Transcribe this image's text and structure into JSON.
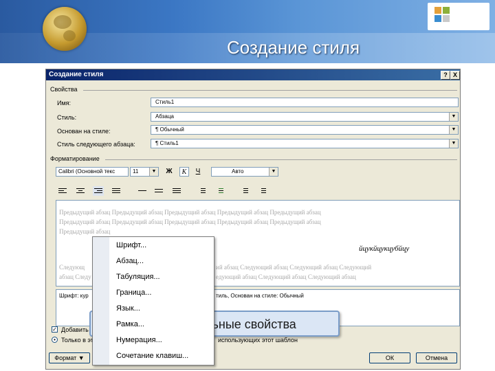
{
  "slide": {
    "title": "Создание стиля",
    "callout_text": "льные свойства"
  },
  "dialog": {
    "title": "Создание стиля",
    "help_button": "?",
    "close_button": "X",
    "properties": {
      "group_label": "Свойства",
      "name_label": "Имя:",
      "name_value": "Стиль1",
      "type_label": "Стиль:",
      "type_value": "Абзаца",
      "based_on_label": "Основан на стиле:",
      "based_on_value": "¶ Обычный",
      "next_style_label": "Стиль следующего абзаца:",
      "next_style_value": "¶ Стиль1"
    },
    "formatting": {
      "group_label": "Форматирование",
      "font_value": "Calibri (Основной текс",
      "size_value": "11",
      "bold_label": "Ж",
      "italic_label": "К",
      "underline_label": "Ч",
      "color_value": "Авто"
    },
    "preview": {
      "prev_line1": "Предыдущий абзац Предыдущий абзац Предыдущий абзац Предыдущий абзац Предыдущий абзац",
      "prev_line2": "Предыдущий абзац Предыдущий абзац Предыдущий абзац Предыдущий абзац Предыдущий абзац",
      "prev_line3": "Предыдущий абзац",
      "sample_text": "йцукйцукцубйцу",
      "next_line1_a": "Следующ",
      "next_line1_b": "ий абзац Следующий абзац Следующий абзац Следующий",
      "next_line2_a": "абзац Следу",
      "next_line2_b": "едующий абзац Следующий абзац Следующий абзац"
    },
    "description": {
      "text_a": "Шрифт: кур",
      "text_b": "тиль, Основан на стиле: Обычный"
    },
    "options": {
      "add_label": "Добавить",
      "only_doc_label": "Только в эт",
      "template_label": "использующих этот шаблон"
    },
    "buttons": {
      "format_label": "Формат ▼",
      "ok_label": "ОК",
      "cancel_label": "Отмена"
    }
  },
  "context_menu": {
    "items": [
      "Шрифт...",
      "Абзац...",
      "Табуляция...",
      "Граница...",
      "Язык...",
      "Рамка...",
      "Нумерация...",
      "Сочетание клавиш..."
    ]
  }
}
